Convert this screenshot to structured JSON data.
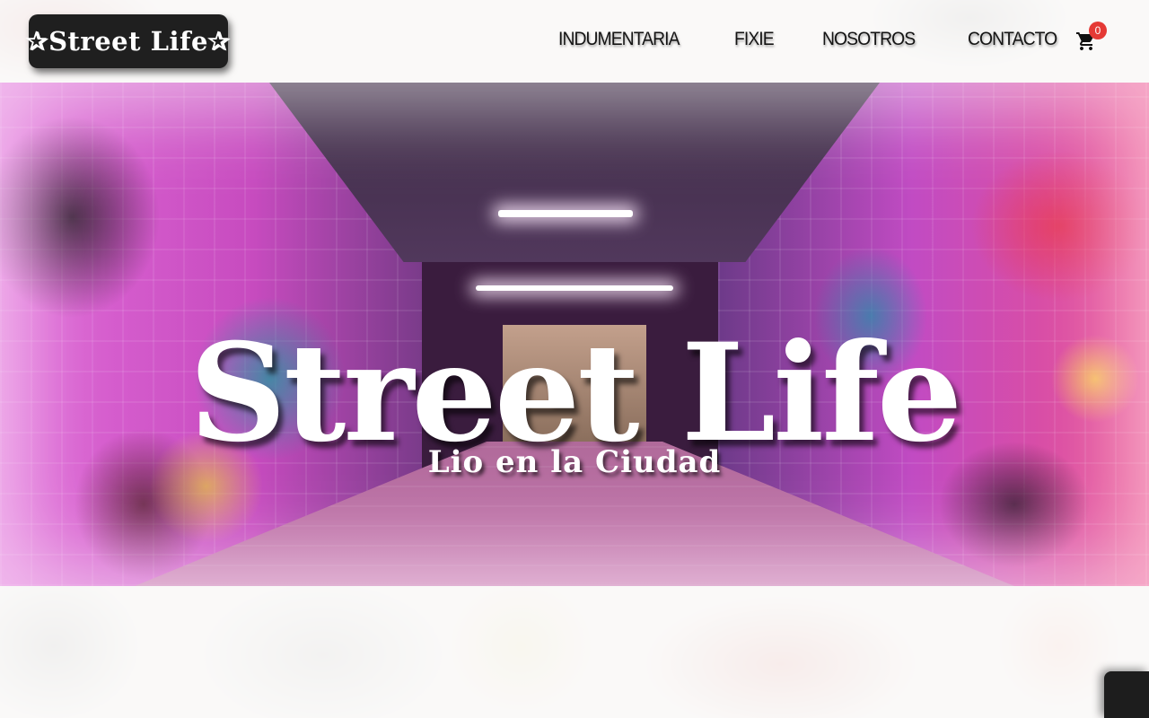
{
  "header": {
    "logo": "✰Street Life✰",
    "nav": [
      {
        "label": "INDUMENTARIA"
      },
      {
        "label": "FIXIE"
      },
      {
        "label": "NOSOTROS"
      },
      {
        "label": "CONTACTO"
      }
    ],
    "cart": {
      "icon": "cart-icon",
      "count": "0",
      "badge_color": "#e53935"
    }
  },
  "hero": {
    "title": "Street Life",
    "subtitle": "Lio en la Ciudad"
  },
  "colors": {
    "logo_background": "#1f1f1f",
    "nav_text": "#141414",
    "hero_text": "#ffffff"
  }
}
